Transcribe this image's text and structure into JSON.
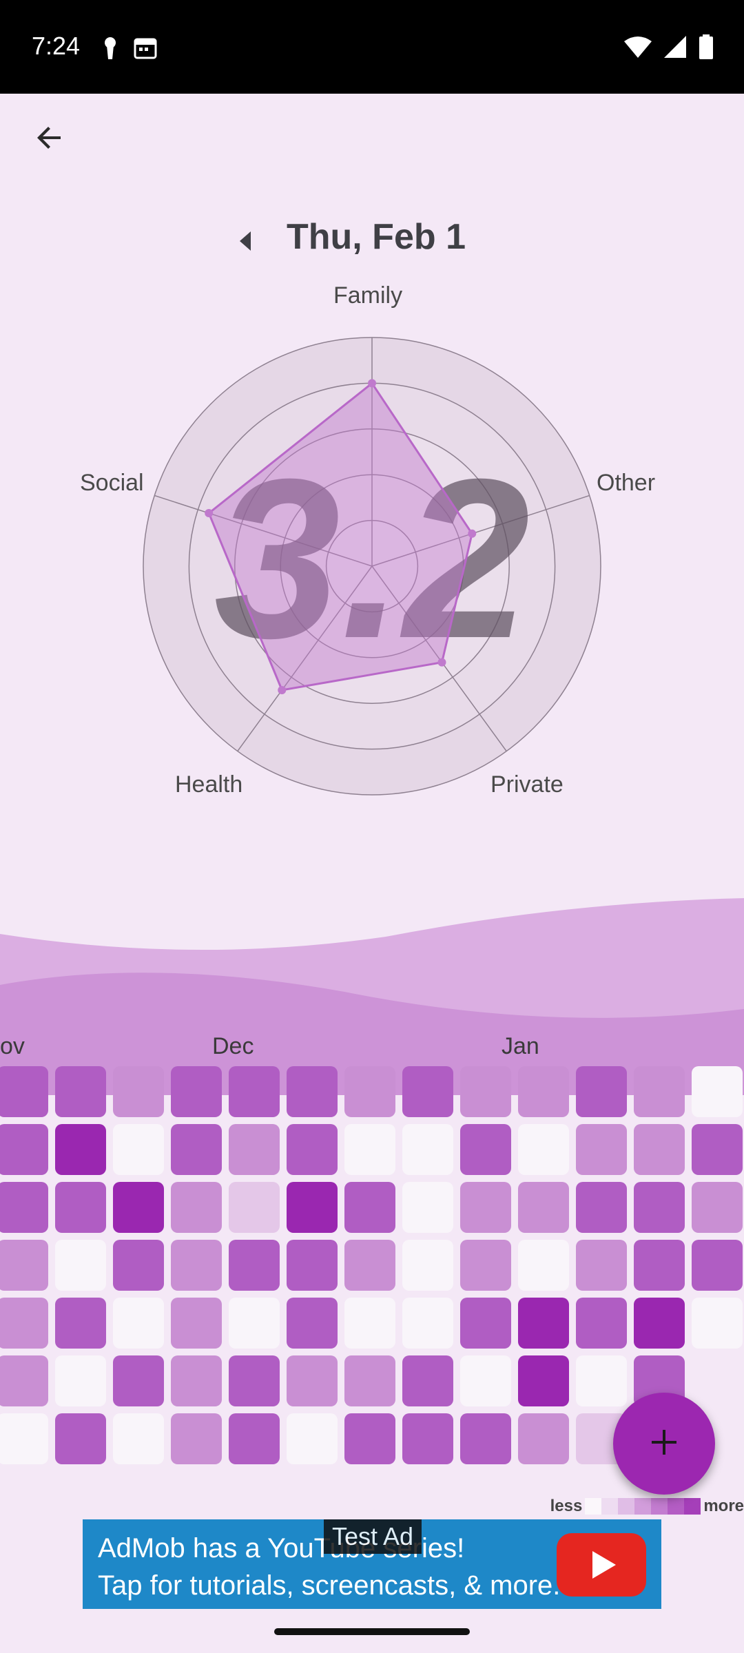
{
  "status": {
    "time": "7:24"
  },
  "header": {
    "date": "Thu, Feb 1"
  },
  "radar": {
    "axes": [
      "Family",
      "Other",
      "Private",
      "Health",
      "Social"
    ],
    "values": [
      0.8,
      0.46,
      0.52,
      0.67,
      0.75
    ],
    "score": "3.2",
    "rings": 5
  },
  "heatmap": {
    "months": [
      {
        "label": "ov",
        "col": 0
      },
      {
        "label": "Dec",
        "col": 4
      },
      {
        "label": "Jan",
        "col": 9
      }
    ],
    "grid": [
      [
        3,
        3,
        2,
        3,
        3,
        3,
        2,
        3,
        2,
        2,
        3,
        2,
        0
      ],
      [
        3,
        4,
        0,
        3,
        2,
        3,
        0,
        0,
        3,
        0,
        2,
        2,
        3
      ],
      [
        3,
        3,
        4,
        2,
        1,
        4,
        3,
        0,
        2,
        2,
        3,
        3,
        2
      ],
      [
        2,
        0,
        3,
        2,
        3,
        3,
        2,
        0,
        2,
        0,
        2,
        3,
        3
      ],
      [
        2,
        3,
        0,
        2,
        0,
        3,
        0,
        0,
        3,
        4,
        3,
        4,
        0
      ],
      [
        2,
        0,
        3,
        2,
        3,
        2,
        2,
        3,
        0,
        4,
        0,
        3,
        null
      ],
      [
        0,
        3,
        0,
        2,
        3,
        0,
        3,
        3,
        3,
        2,
        1,
        null,
        null
      ]
    ],
    "legend_less": "less",
    "legend_more": "more"
  },
  "colors": {
    "level0": "#f9f5fa",
    "level1": "#e4c7e8",
    "level2": "#c98fd3",
    "level3": "#b05dc3",
    "level4": "#9a27b0",
    "accent": "#9c27b0"
  },
  "ad": {
    "line1": "AdMob has a YouTube series!",
    "line2": "Tap for tutorials, screencasts, & more.",
    "tag": "Test Ad"
  }
}
